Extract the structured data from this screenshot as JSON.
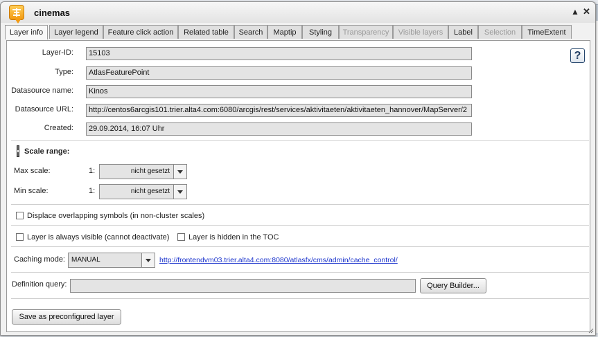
{
  "window": {
    "title": "cinemas"
  },
  "tabs": [
    {
      "label": "Layer info",
      "state": "active"
    },
    {
      "label": "Layer legend",
      "state": "normal"
    },
    {
      "label": "Feature click action",
      "state": "normal"
    },
    {
      "label": "Related table",
      "state": "normal"
    },
    {
      "label": "Search",
      "state": "normal"
    },
    {
      "label": "Maptip",
      "state": "normal"
    },
    {
      "label": "Styling",
      "state": "normal"
    },
    {
      "label": "Transparency",
      "state": "disabled"
    },
    {
      "label": "Visible layers",
      "state": "disabled"
    },
    {
      "label": "Label",
      "state": "normal"
    },
    {
      "label": "Selection",
      "state": "disabled"
    },
    {
      "label": "TimeExtent",
      "state": "normal"
    }
  ],
  "info": {
    "layer_id_label": "Layer-ID:",
    "layer_id": "15103",
    "type_label": "Type:",
    "type": "AtlasFeaturePoint",
    "ds_name_label": "Datasource name:",
    "ds_name": "Kinos",
    "ds_url_label": "Datasource URL:",
    "ds_url": "http://centos6arcgis101.trier.alta4.com:6080/arcgis/rest/services/aktivitaeten/aktivitaeten_hannover/MapServer/2",
    "created_label": "Created:",
    "created": "29.09.2014, 16:07 Uhr",
    "help_glyph": "?"
  },
  "scale": {
    "heading": "Scale range:",
    "max_label": "Max scale:",
    "min_label": "Min scale:",
    "prefix": "1:",
    "max_value": "nicht gesetzt",
    "min_value": "nicht gesetzt"
  },
  "options": {
    "displace": "Displace overlapping symbols (in non-cluster scales)",
    "always_visible": "Layer is always visible (cannot deactivate)",
    "hidden_toc": "Layer is hidden in the TOC"
  },
  "caching": {
    "label": "Caching mode:",
    "value": "MANUAL",
    "link": "http://frontendvm03.trier.alta4.com:8080/atlasfx/cms/admin/cache_control/"
  },
  "query": {
    "label": "Definition query:",
    "value": "",
    "builder_button": "Query Builder..."
  },
  "save_button": "Save as preconfigured layer"
}
